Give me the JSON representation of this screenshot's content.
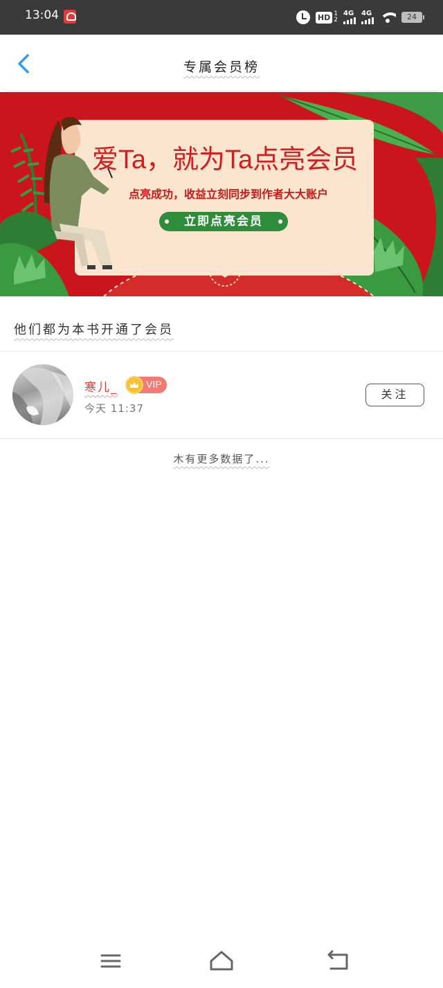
{
  "status_bar": {
    "time": "13:04",
    "hd_label": "HD",
    "hd_sup": "1",
    "hd_sub": "2",
    "network1": "4G",
    "network2": "4G",
    "battery": "24"
  },
  "header": {
    "title": "专属会员榜"
  },
  "banner": {
    "headline": "爱Ta，就为Ta点亮会员",
    "subtitle": "点亮成功，收益立刻同步到作者大大账户",
    "cta_label": "立即点亮会员"
  },
  "section": {
    "title": "他们都为本书开通了会员"
  },
  "members": [
    {
      "name": "寒儿_",
      "badge": "VIP",
      "time": "今天 11:37",
      "follow_label": "关注"
    }
  ],
  "footer_note": "木有更多数据了...",
  "colors": {
    "accent_blue": "#2a9df4",
    "banner_red": "#c9151b",
    "name_red": "#e0403a",
    "cta_green": "#2f8c3a"
  },
  "icons": {
    "back": "chevron-left-icon",
    "nav_menu": "menu-icon",
    "nav_home": "home-icon",
    "nav_back": "return-icon"
  }
}
